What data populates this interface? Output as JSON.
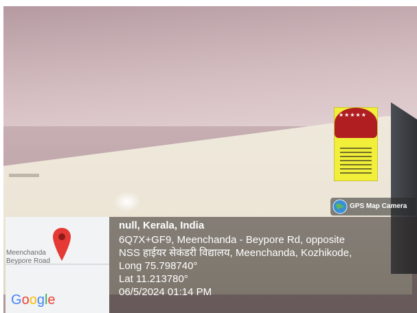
{
  "badge": {
    "label": "GPS Map Camera",
    "icon": "globe-icon"
  },
  "map": {
    "place_line1": "Meenchanda",
    "place_line2": "Beypore Road",
    "logo": [
      "G",
      "o",
      "o",
      "g",
      "l",
      "e"
    ],
    "pin_color": "#e53935"
  },
  "location": {
    "title": "null, Kerala, India",
    "address_line1": "6Q7X+GF9, Meenchanda - Beypore Rd, opposite",
    "address_line2": "NSS हाईयर सेकंडरी विद्यालय, Meenchanda, Kozhikode,",
    "longitude": "Long 75.798740°",
    "latitude": "Lat 11.213780°",
    "datetime": "06/5/2024 01:14 PM"
  }
}
